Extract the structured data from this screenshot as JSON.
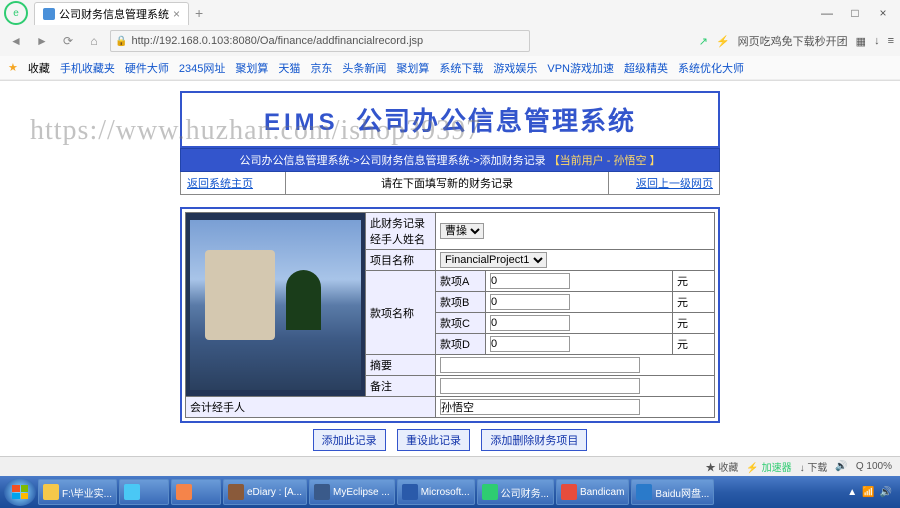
{
  "browser": {
    "tab_title": "公司财务信息管理系统",
    "url": "http://192.168.0.103:8080/Oa/finance/addfinancialrecord.jsp",
    "right_text": "网页吃鸡免下载秒开团",
    "bookmarks_label": "收藏",
    "bookmarks": [
      "手机收藏夹",
      "硬件大师",
      "2345网址",
      "聚划算",
      "天猫",
      "京东",
      "头条新闻",
      "聚划算",
      "系统下载",
      "游戏娱乐",
      "VPN游戏加速",
      "超级精英",
      "系统优化大师"
    ]
  },
  "watermark": "https://www.huzhan.com/ishop39397",
  "header": {
    "eims": "EIMS",
    "title": "公司办公信息管理系统"
  },
  "breadcrumb": {
    "path": "公司办公信息管理系统->公司财务信息管理系统->添加财务记录",
    "user_label": "【当前用户 - 孙悟空 】"
  },
  "links": {
    "left": "返回系统主页",
    "middle": "请在下面填写新的财务记录",
    "right": "返回上一级网页"
  },
  "form": {
    "handler_label": "此财务记录经手人姓名",
    "handler_option": "曹操",
    "project_label": "项目名称",
    "project_option": "FinancialProject1",
    "amount_group_label": "款项名称",
    "items": [
      {
        "label": "款项A",
        "value": "0",
        "unit": "元"
      },
      {
        "label": "款项B",
        "value": "0",
        "unit": "元"
      },
      {
        "label": "款项C",
        "value": "0",
        "unit": "元"
      },
      {
        "label": "款项D",
        "value": "0",
        "unit": "元"
      }
    ],
    "summary_label": "摘要",
    "remark_label": "备注",
    "accountant_label": "会计经手人",
    "accountant_value": "孙悟空"
  },
  "buttons": {
    "add": "添加此记录",
    "reset": "重设此记录",
    "add_item": "添加删除财务项目"
  },
  "status": {
    "fav": "收藏",
    "accel": "加速器",
    "download": "下载",
    "zoom": "100%"
  },
  "taskbar": {
    "items": [
      {
        "label": "F:\\毕业实...",
        "color": "#f5c84a"
      },
      {
        "label": "",
        "color": "#4ac8f5"
      },
      {
        "label": "",
        "color": "#f5844a"
      },
      {
        "label": "eDiary : [A...",
        "color": "#8a5a3a"
      },
      {
        "label": "MyEclipse ...",
        "color": "#3a5a8a"
      },
      {
        "label": "Microsoft...",
        "color": "#2a5aaa"
      },
      {
        "label": "公司财务...",
        "color": "#2ecc71"
      },
      {
        "label": "Bandicam",
        "color": "#e74c3c"
      },
      {
        "label": "Baidu网盘...",
        "color": "#2a7aca"
      }
    ]
  }
}
